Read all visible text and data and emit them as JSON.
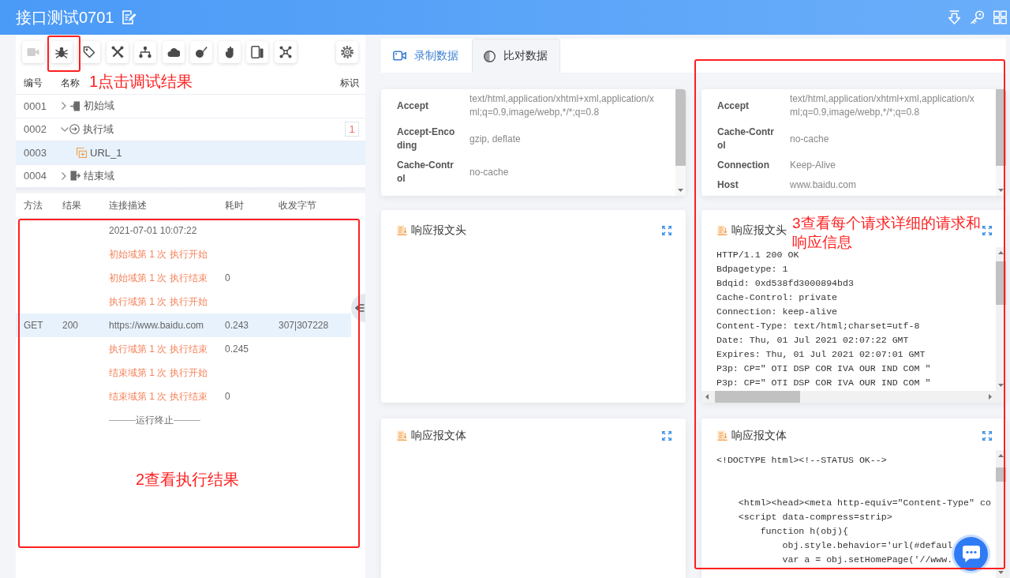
{
  "header": {
    "title": "接口测试0701"
  },
  "toolbar": {
    "tools": [
      {
        "disabled": true
      },
      {
        "disabled": false
      },
      {
        "disabled": false
      },
      {
        "disabled": false
      },
      {
        "disabled": false
      },
      {
        "disabled": false
      },
      {
        "disabled": false
      },
      {
        "disabled": false
      },
      {
        "disabled": false
      },
      {
        "disabled": false
      }
    ]
  },
  "tree": {
    "columns": [
      "编号",
      "名称",
      "标识"
    ],
    "nodes": [
      {
        "number": "0001",
        "label": "初始域",
        "kind": "start",
        "expanded": false,
        "selected": false
      },
      {
        "number": "0002",
        "label": "执行域",
        "kind": "exec",
        "expanded": true,
        "selected": false,
        "flag": "1",
        "children": [
          {
            "number": "0003",
            "label": "URL_1",
            "kind": "url",
            "selected": true
          }
        ]
      },
      {
        "number": "0004",
        "label": "结束域",
        "kind": "end",
        "expanded": false,
        "selected": false
      }
    ]
  },
  "results": {
    "columns": [
      "方法",
      "结果",
      "连接描述",
      "耗时",
      "收发字节"
    ],
    "rows": [
      {
        "kind": "time",
        "description": "2021-07-01 10:07:22",
        "selected": false
      },
      {
        "kind": "event",
        "description": "初始域第 1 次 执行开始",
        "selected": false
      },
      {
        "kind": "event",
        "description": "初始域第 1 次 执行结束",
        "duration": "0",
        "selected": false
      },
      {
        "kind": "event",
        "description": "执行域第 1 次 执行开始",
        "selected": false
      },
      {
        "kind": "request",
        "method": "GET",
        "result": "200",
        "description": "https://www.baidu.com",
        "duration": "0.243",
        "bytes": "307|307228",
        "selected": true
      },
      {
        "kind": "event",
        "description": "执行域第 1 次 执行结束",
        "duration": "0.245",
        "selected": false
      },
      {
        "kind": "event",
        "description": "结束域第 1 次 执行开始",
        "selected": false
      },
      {
        "kind": "event",
        "description": "结束域第 1 次 执行结束",
        "duration": "0",
        "selected": false
      },
      {
        "kind": "end",
        "description": "运行终止",
        "selected": false
      }
    ]
  },
  "tabs": [
    {
      "label": "录制数据",
      "selected": false
    },
    {
      "label": "比对数据",
      "selected": true
    }
  ],
  "compare": [
    {
      "request_headers": [
        {
          "name": "Accept",
          "value": "text/html,application/xhtml+xml,application/xml;q=0.9,image/webp,*/*;q=0.8"
        },
        {
          "name": "Accept-Encoding",
          "value": "gzip, deflate"
        },
        {
          "name": "Cache-Control",
          "value": "no-cache"
        }
      ],
      "response_header": {
        "title": "响应报文头"
      },
      "response_body": {
        "title": "响应报文体"
      }
    },
    {
      "request_headers": [
        {
          "name": "Accept",
          "value": "text/html,application/xhtml+xml,application/xml;q=0.9,image/webp,*/*;q=0.8"
        },
        {
          "name": "Cache-Control",
          "value": "no-cache"
        },
        {
          "name": "Connection",
          "value": "Keep-Alive"
        },
        {
          "name": "Host",
          "value": "www.baidu.com"
        }
      ],
      "response_header": {
        "title": "响应报文头",
        "text": "HTTP/1.1 200 OK\nBdpagetype: 1\nBdqid: 0xd538fd3000894bd3\nCache-Control: private\nConnection: keep-alive\nContent-Type: text/html;charset=utf-8\nDate: Thu, 01 Jul 2021 02:07:22 GMT\nExpires: Thu, 01 Jul 2021 02:07:01 GMT\nP3p: CP=\" OTI DSP COR IVA OUR IND COM \"\nP3p: CP=\" OTI DSP COR IVA OUR IND COM \""
      },
      "response_body": {
        "title": "响应报文体",
        "text": "<!DOCTYPE html><!--STATUS OK-->\n\n\n    <html><head><meta http-equiv=\"Content-Type\" co\n    <script data-compress=strip>\n        function h(obj){\n            obj.style.behavior='url(#defaul\n            var a = obj.setHomePage('//www."
      }
    }
  ],
  "annotations": [
    "1点击调试结果",
    "2查看执行结果",
    "3查看每个请求详细的请求和响应信息"
  ]
}
